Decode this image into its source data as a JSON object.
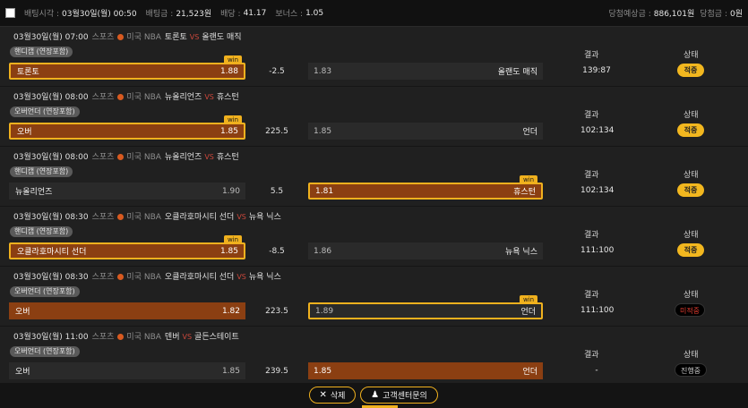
{
  "topbar": {
    "time_label": "배팅시각 :",
    "time_value": "03월30일(월) 00:50",
    "amount_label": "배팅금 :",
    "amount_value": "21,523원",
    "odds_label": "배당 :",
    "odds_value": "41.17",
    "bonus_label": "보너스 :",
    "bonus_value": "1.05",
    "expected_label": "당첨예상금 :",
    "expected_value": "886,101원",
    "won_label": "당첨금 :",
    "won_value": "0원"
  },
  "columns": {
    "result": "결과",
    "status": "상태"
  },
  "win_label": "win",
  "bets": [
    {
      "date": "03월30일(월) 07:00",
      "sport": "스포츠",
      "league": "미국 NBA",
      "home_team": "토론토",
      "vs": "VS",
      "away_team": "올랜도 매직",
      "market": "핸디캡 (연장포함)",
      "home_name": "토론토",
      "home_odds": "1.88",
      "handicap": "-2.5",
      "away_odds": "1.83",
      "away_name": "올랜도 매직",
      "result": "139:87",
      "status": "적중"
    },
    {
      "date": "03월30일(월) 08:00",
      "sport": "스포츠",
      "league": "미국 NBA",
      "home_team": "뉴올리언즈",
      "vs": "VS",
      "away_team": "휴스턴",
      "market": "오버언더 (연장포함)",
      "home_name": "오버",
      "home_odds": "1.85",
      "handicap": "225.5",
      "away_odds": "1.85",
      "away_name": "언더",
      "result": "102:134",
      "status": "적중"
    },
    {
      "date": "03월30일(월) 08:00",
      "sport": "스포츠",
      "league": "미국 NBA",
      "home_team": "뉴올리언즈",
      "vs": "VS",
      "away_team": "휴스턴",
      "market": "핸디캡 (연장포함)",
      "home_name": "뉴올리언즈",
      "home_odds": "1.90",
      "handicap": "5.5",
      "away_odds": "1.81",
      "away_name": "휴스턴",
      "result": "102:134",
      "status": "적중"
    },
    {
      "date": "03월30일(월) 08:30",
      "sport": "스포츠",
      "league": "미국 NBA",
      "home_team": "오클라호마시티 선더",
      "vs": "VS",
      "away_team": "뉴욕 닉스",
      "market": "핸디캡 (연장포함)",
      "home_name": "오클라호마시티 선더",
      "home_odds": "1.85",
      "handicap": "-8.5",
      "away_odds": "1.86",
      "away_name": "뉴욕 닉스",
      "result": "111:100",
      "status": "적중"
    },
    {
      "date": "03월30일(월) 08:30",
      "sport": "스포츠",
      "league": "미국 NBA",
      "home_team": "오클라호마시티 선더",
      "vs": "VS",
      "away_team": "뉴욕 닉스",
      "market": "오버언더 (연장포함)",
      "home_name": "오버",
      "home_odds": "1.82",
      "handicap": "223.5",
      "away_odds": "1.89",
      "away_name": "언더",
      "result": "111:100",
      "status": "미적중"
    },
    {
      "date": "03월30일(월) 11:00",
      "sport": "스포츠",
      "league": "미국 NBA",
      "home_team": "덴버",
      "vs": "VS",
      "away_team": "골든스테이트",
      "market": "오버언더 (연장포함)",
      "home_name": "오버",
      "home_odds": "1.85",
      "handicap": "239.5",
      "away_odds": "1.85",
      "away_name": "언더",
      "result": "-",
      "status": "진행중"
    }
  ],
  "footer": {
    "delete_label": "삭제",
    "support_label": "고객센터문의"
  },
  "colors": {
    "accent": "#f0b11e",
    "selected": "#8b3f12",
    "miss": "#e03b2f"
  }
}
